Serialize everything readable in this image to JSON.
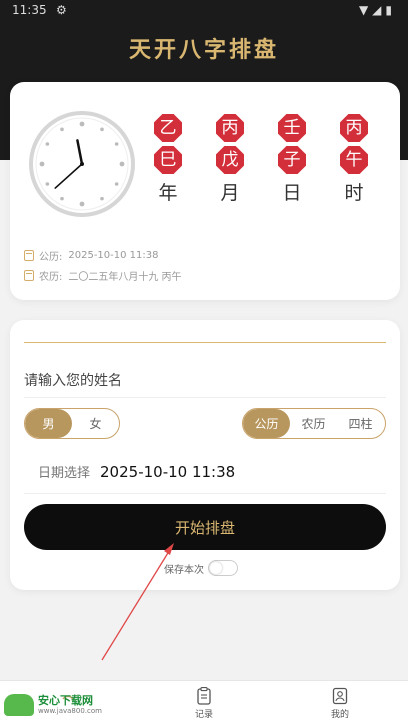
{
  "status_bar": {
    "time": "11:35",
    "indicator": "⚙",
    "icons": "▼◢▮"
  },
  "header": {
    "title": "天开八字排盘"
  },
  "clock": {
    "hour": 11,
    "minute": 38
  },
  "pillars": [
    {
      "stem": "乙",
      "branch": "巳",
      "label": "年"
    },
    {
      "stem": "丙",
      "branch": "戊",
      "label": "月"
    },
    {
      "stem": "壬",
      "branch": "子",
      "label": "日"
    },
    {
      "stem": "丙",
      "branch": "午",
      "label": "时"
    }
  ],
  "info": {
    "solar_label": "公历:",
    "solar_value": "2025-10-10 11:38",
    "lunar_label": "农历:",
    "lunar_value": "二〇二五年八月十九 丙午"
  },
  "form": {
    "name_placeholder": "请输入您的姓名",
    "gender_options": [
      "男",
      "女"
    ],
    "gender_selected": "男",
    "calendar_options": [
      "公历",
      "农历",
      "四柱"
    ],
    "calendar_selected": "公历",
    "date_label": "日期选择",
    "date_value": "2025-10-10 11:38",
    "start_button": "开始排盘",
    "save_label": "保存本次",
    "save_enabled": false
  },
  "nav": {
    "records_label": "记录",
    "mine_label": "我的"
  },
  "watermark": {
    "name": "安心下载网",
    "url": "www.java800.com"
  },
  "colors": {
    "accent_gold": "#d9b771",
    "seal_red": "#d32f3a",
    "header_bg": "#1b1b1b"
  }
}
